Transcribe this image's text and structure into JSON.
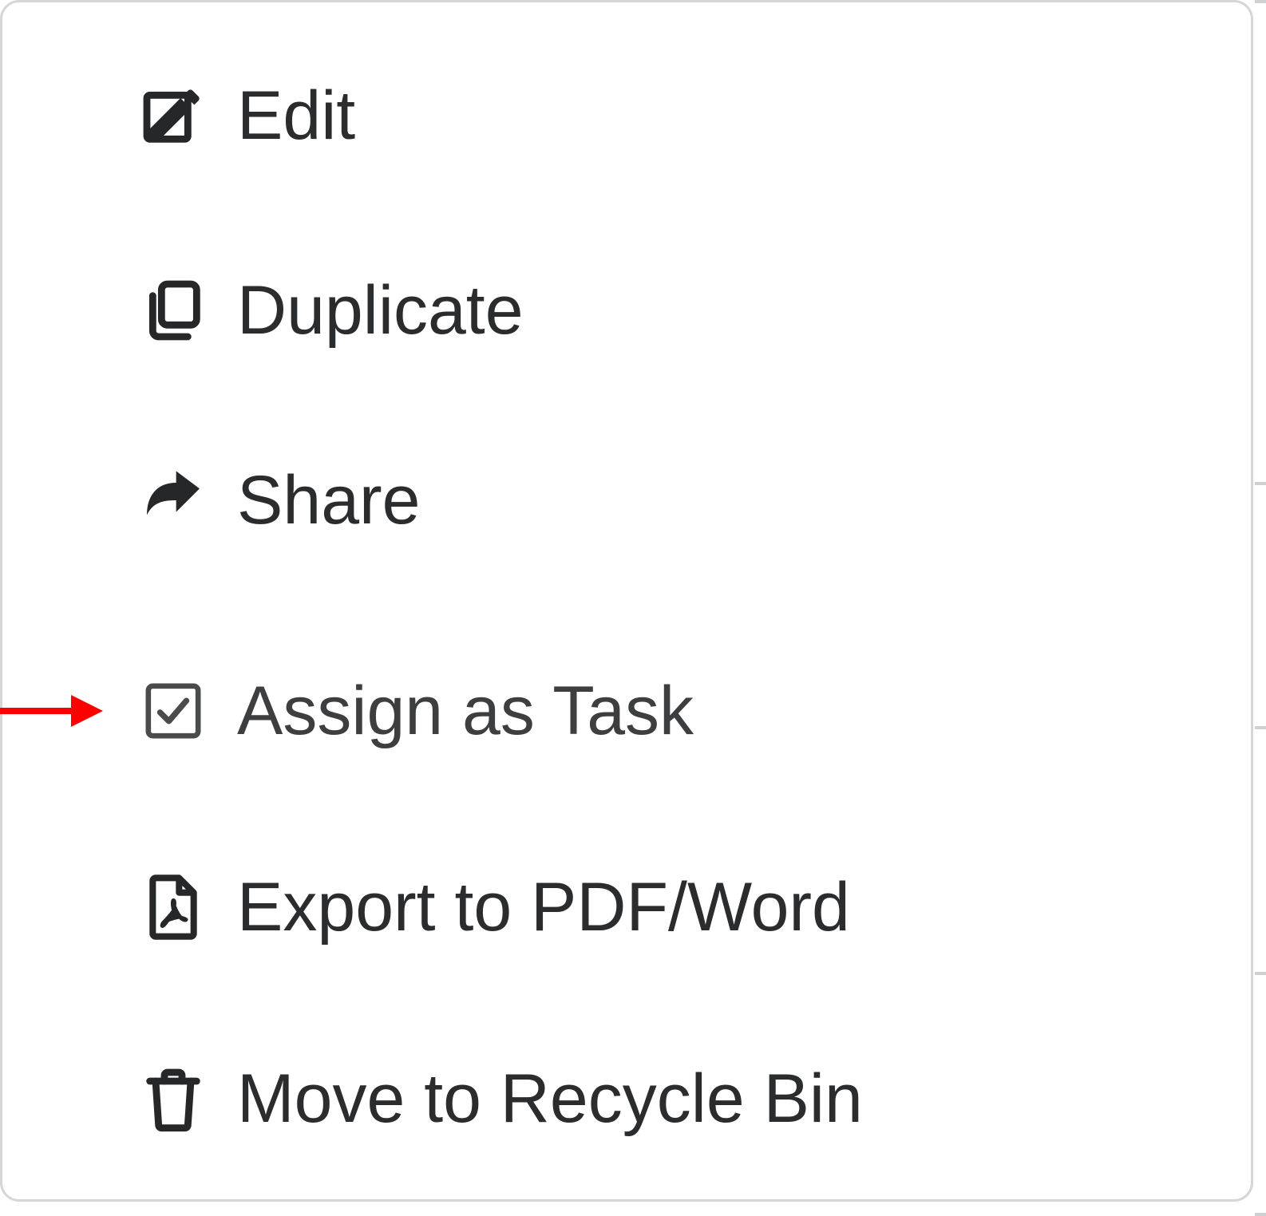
{
  "menu": {
    "items": [
      {
        "label": "Edit",
        "icon": "edit-icon"
      },
      {
        "label": "Duplicate",
        "icon": "duplicate-icon"
      },
      {
        "label": "Share",
        "icon": "share-icon"
      },
      {
        "label": "Assign as Task",
        "icon": "checkbox-icon",
        "highlighted": true
      },
      {
        "label": "Export to PDF/Word",
        "icon": "file-pdf-icon"
      },
      {
        "label": "Move to Recycle Bin",
        "icon": "trash-icon"
      }
    ]
  },
  "annotation": {
    "arrow_color": "#ff0000"
  }
}
